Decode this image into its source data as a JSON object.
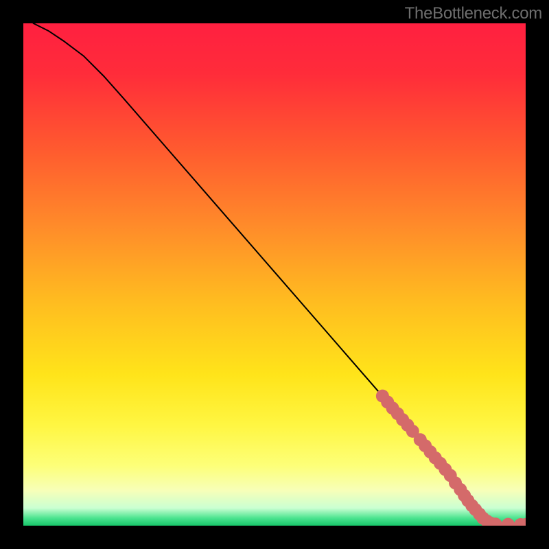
{
  "watermark": "TheBottleneck.com",
  "chart_data": {
    "type": "line",
    "title": "",
    "xlabel": "",
    "ylabel": "",
    "xlim": [
      0,
      100
    ],
    "ylim": [
      0,
      100
    ],
    "background_gradient_stops": [
      {
        "offset": 0.0,
        "color": "#ff2040"
      },
      {
        "offset": 0.1,
        "color": "#ff2c3a"
      },
      {
        "offset": 0.25,
        "color": "#ff5a2f"
      },
      {
        "offset": 0.4,
        "color": "#ff8a2a"
      },
      {
        "offset": 0.55,
        "color": "#ffbb20"
      },
      {
        "offset": 0.7,
        "color": "#ffe41a"
      },
      {
        "offset": 0.8,
        "color": "#fff642"
      },
      {
        "offset": 0.88,
        "color": "#fdff78"
      },
      {
        "offset": 0.93,
        "color": "#f7ffb8"
      },
      {
        "offset": 0.965,
        "color": "#caffd2"
      },
      {
        "offset": 0.985,
        "color": "#4be38f"
      },
      {
        "offset": 1.0,
        "color": "#18c66a"
      }
    ],
    "curve": [
      {
        "x": 2,
        "y": 100
      },
      {
        "x": 5,
        "y": 98.5
      },
      {
        "x": 8,
        "y": 96.5
      },
      {
        "x": 12,
        "y": 93.5
      },
      {
        "x": 16,
        "y": 89.5
      },
      {
        "x": 20,
        "y": 85
      },
      {
        "x": 30,
        "y": 73.5
      },
      {
        "x": 40,
        "y": 62
      },
      {
        "x": 50,
        "y": 50.5
      },
      {
        "x": 60,
        "y": 39
      },
      {
        "x": 70,
        "y": 27.5
      },
      {
        "x": 80,
        "y": 16
      },
      {
        "x": 86,
        "y": 8.5
      },
      {
        "x": 90,
        "y": 3.5
      },
      {
        "x": 92,
        "y": 1.2
      },
      {
        "x": 95,
        "y": 0.3
      },
      {
        "x": 100,
        "y": 0.2
      }
    ],
    "series": [
      {
        "name": "points",
        "color": "#d46a6a",
        "radius_frac": 0.013,
        "points": [
          {
            "x": 71.5,
            "y": 25.8
          },
          {
            "x": 72.5,
            "y": 24.6
          },
          {
            "x": 73.5,
            "y": 23.4
          },
          {
            "x": 74.5,
            "y": 22.3
          },
          {
            "x": 75.5,
            "y": 21.1
          },
          {
            "x": 76.5,
            "y": 20.0
          },
          {
            "x": 77.5,
            "y": 18.8
          },
          {
            "x": 79.0,
            "y": 17.1
          },
          {
            "x": 80.0,
            "y": 15.9
          },
          {
            "x": 81.0,
            "y": 14.7
          },
          {
            "x": 82.0,
            "y": 13.5
          },
          {
            "x": 83.0,
            "y": 12.4
          },
          {
            "x": 84.0,
            "y": 11.2
          },
          {
            "x": 85.0,
            "y": 10.0
          },
          {
            "x": 86.0,
            "y": 8.5
          },
          {
            "x": 87.0,
            "y": 7.2
          },
          {
            "x": 87.8,
            "y": 6.0
          },
          {
            "x": 88.5,
            "y": 5.0
          },
          {
            "x": 89.3,
            "y": 4.0
          },
          {
            "x": 90.0,
            "y": 3.2
          },
          {
            "x": 90.8,
            "y": 2.3
          },
          {
            "x": 91.5,
            "y": 1.5
          },
          {
            "x": 92.3,
            "y": 0.9
          },
          {
            "x": 93.0,
            "y": 0.5
          },
          {
            "x": 94.0,
            "y": 0.3
          },
          {
            "x": 96.5,
            "y": 0.25
          },
          {
            "x": 99.0,
            "y": 0.2
          },
          {
            "x": 100.0,
            "y": 0.2
          }
        ]
      }
    ]
  }
}
